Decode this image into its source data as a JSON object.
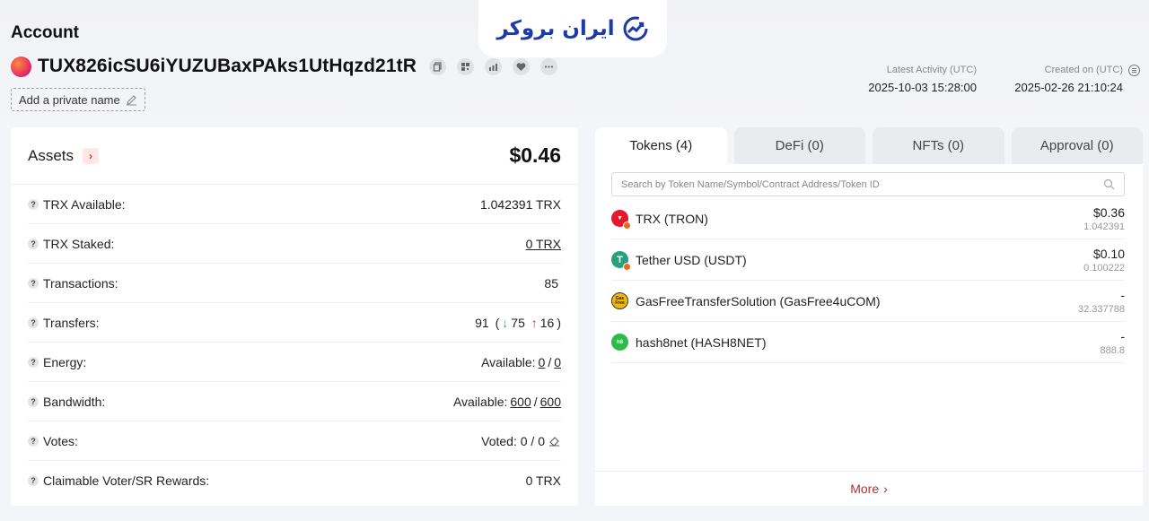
{
  "header": {
    "title": "Account",
    "address": "TUX826icSU6iYUZUBaxPAks1UtHqzd21tR",
    "private_name_label": "Add a private name",
    "logo_text": "ایران بروکر"
  },
  "meta": {
    "latest_activity_label": "Latest Activity (UTC)",
    "latest_activity_value": "2025-10-03 15:28:00",
    "created_label": "Created on (UTC)",
    "created_value": "2025-02-26 21:10:24"
  },
  "assets": {
    "title": "Assets",
    "total": "$0.46",
    "rows": [
      {
        "label": "TRX Available:",
        "value": "1.042391 TRX"
      },
      {
        "label": "TRX Staked:",
        "value": "0 TRX"
      },
      {
        "label": "Transactions:",
        "value": "85"
      },
      {
        "label": "Transfers:",
        "total": "91",
        "in": "75",
        "out": "16"
      },
      {
        "label": "Energy:",
        "prefix": "Available:",
        "a": "0",
        "b": "0"
      },
      {
        "label": "Bandwidth:",
        "prefix": "Available:",
        "a": "600",
        "b": "600"
      },
      {
        "label": "Votes:",
        "value": "Voted: 0 / 0"
      },
      {
        "label": "Claimable Voter/SR Rewards:",
        "value": "0 TRX"
      }
    ]
  },
  "tabs": [
    {
      "label": "Tokens",
      "count": "(4)"
    },
    {
      "label": "DeFi",
      "count": "(0)"
    },
    {
      "label": "NFTs",
      "count": "(0)"
    },
    {
      "label": "Approval",
      "count": "(0)"
    }
  ],
  "search": {
    "placeholder": "Search by Token Name/Symbol/Contract Address/Token ID"
  },
  "tokens": [
    {
      "name": "TRX (TRON)",
      "usd": "$0.36",
      "amount": "1.042391",
      "icon": "tron-icon",
      "color": "#e5172b"
    },
    {
      "name": "Tether USD (USDT)",
      "usd": "$0.10",
      "amount": "0.100222",
      "icon": "tether-icon",
      "color": "#26a17b"
    },
    {
      "name": "GasFreeTransferSolution (GasFree4uCOM)",
      "usd": "-",
      "amount": "32.337788",
      "icon": "gasfree-icon",
      "color": "#f2b705"
    },
    {
      "name": "hash8net (HASH8NET)",
      "usd": "-",
      "amount": "888.8",
      "icon": "hash8net-icon",
      "color": "#2dbb4a"
    }
  ],
  "more_label": "More"
}
